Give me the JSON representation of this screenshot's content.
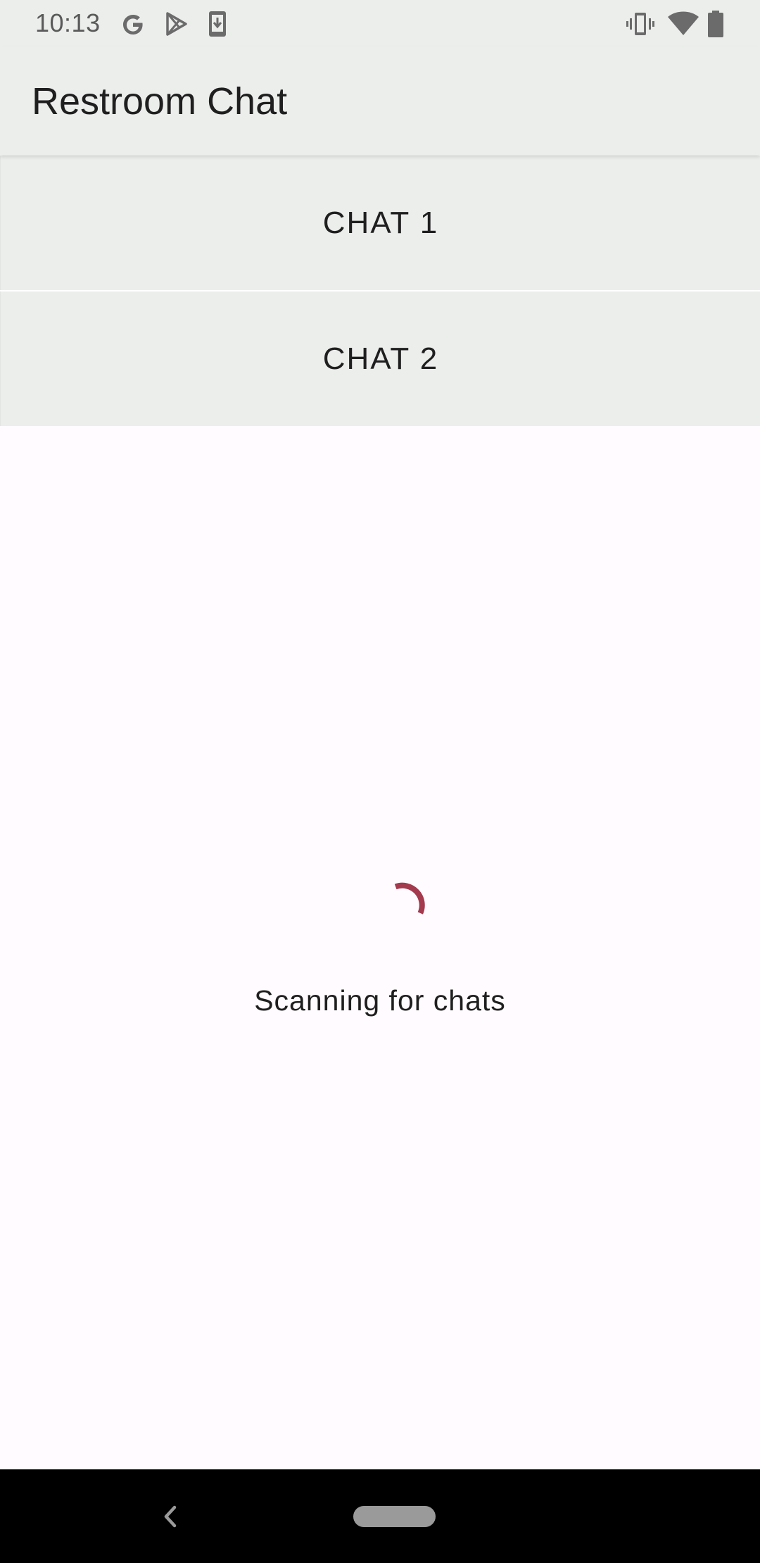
{
  "status_bar": {
    "time": "10:13",
    "left_icons": [
      "google-icon",
      "play-store-icon",
      "download-icon"
    ],
    "right_icons": [
      "vibrate-icon",
      "wifi-icon",
      "battery-icon"
    ]
  },
  "app_bar": {
    "title": "Restroom Chat"
  },
  "chats": [
    {
      "label": "CHAT 1"
    },
    {
      "label": "CHAT 2"
    }
  ],
  "loading": {
    "message": "Scanning for chats",
    "spinner_color": "#a33a4e"
  },
  "nav_bar": {
    "icons": [
      "back-icon",
      "home-pill-icon"
    ]
  },
  "colors": {
    "bar_background": "#eceeec",
    "page_background": "#fffbfe",
    "text": "#1f1f1f",
    "accent": "#a33a4e"
  }
}
